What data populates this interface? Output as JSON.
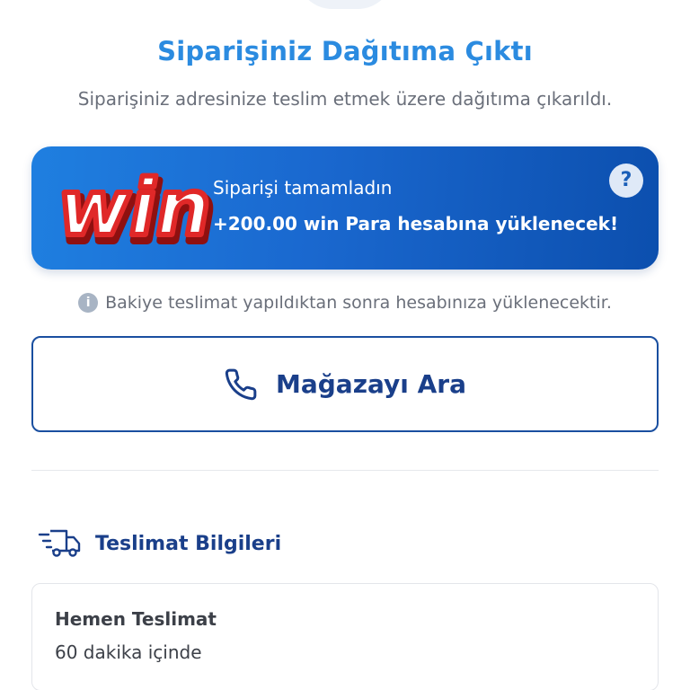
{
  "header": {
    "title": "Siparişiniz Dağıtıma Çıktı",
    "subtitle": "Siparişiniz adresinize teslim etmek üzere dağıtıma çıkarıldı."
  },
  "win_banner": {
    "logo_text": "win",
    "line1": "Siparişi tamamladın",
    "line2": "+200.00 win Para hesabına yüklenecek!",
    "help_symbol": "?",
    "colors": {
      "gradient_start": "#1f7fe0",
      "gradient_end": "#0c4fae",
      "logo_red": "#e02828"
    }
  },
  "info_note": {
    "icon": "info-icon",
    "icon_symbol": "i",
    "text": "Bakiye teslimat yapıldıktan sonra hesabınıza yüklenecektir."
  },
  "call_store": {
    "icon": "phone-icon",
    "label": "Mağazayı Ara"
  },
  "delivery_section": {
    "icon": "truck-icon",
    "title": "Teslimat Bilgileri",
    "card": {
      "title": "Hemen Teslimat",
      "time": "60 dakika içinde"
    }
  },
  "theme": {
    "accent_blue": "#2b8be0",
    "dark_blue": "#1a3f8a",
    "muted_text": "#6a6f7a"
  }
}
